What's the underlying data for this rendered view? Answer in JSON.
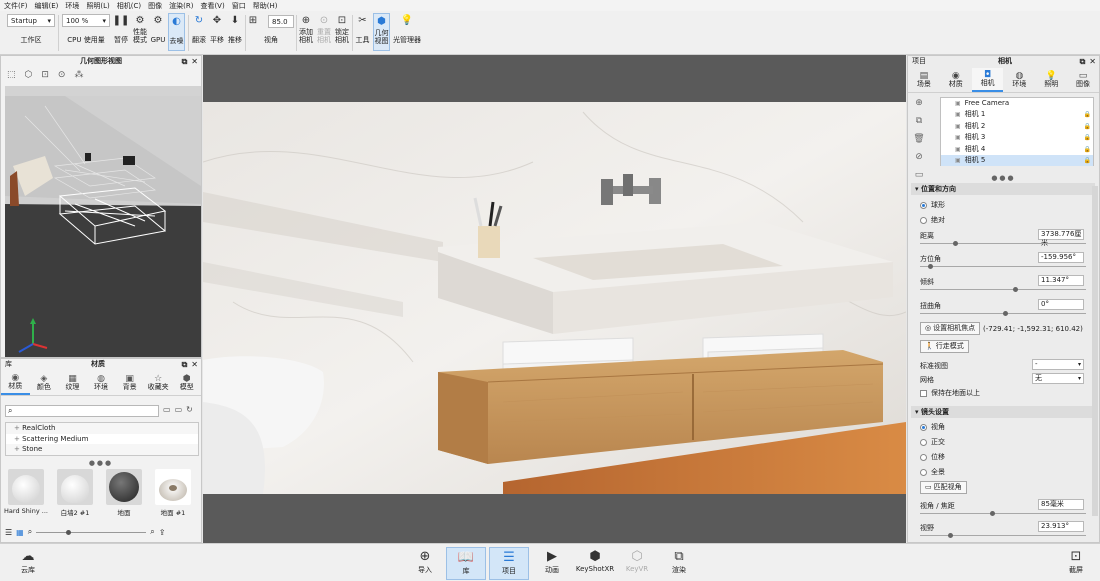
{
  "menu": [
    "文件(F)",
    "编辑(E)",
    "环境",
    "照明(L)",
    "相机(C)",
    "图像",
    "渲染(R)",
    "查看(V)",
    "窗口",
    "帮助(H)"
  ],
  "toolbar": {
    "workspace_value": "Startup",
    "workspace_label": "工作区",
    "cpu_value": "100 %",
    "cpu_label": "CPU 使用量",
    "pause": "暂停",
    "perf": "性能\n模式",
    "gpu": "GPU",
    "denoise": "去噪",
    "flip": "翻滚",
    "pan": "平移",
    "dolly": "推移",
    "fov_value": "85.0",
    "fov_label": "视角",
    "add_camera": "添加\n相机",
    "reset_camera": "重置\n相机",
    "lock_camera": "锁定\n相机",
    "tools": "工具",
    "geo_view": "几何\n视图",
    "light_manager": "光管理器"
  },
  "geometry_panel": {
    "title": "几何图形视图"
  },
  "library_panel": {
    "title": "材质",
    "tabs": [
      {
        "label": "材质",
        "icon": "material-icon"
      },
      {
        "label": "颜色",
        "icon": "color-icon"
      },
      {
        "label": "纹理",
        "icon": "texture-icon"
      },
      {
        "label": "环境",
        "icon": "environment-icon"
      },
      {
        "label": "背景",
        "icon": "background-icon"
      },
      {
        "label": "收藏夹",
        "icon": "favorites-icon"
      },
      {
        "label": "模型",
        "icon": "model-icon"
      }
    ],
    "tree": [
      "RealCloth",
      "Scattering Medium",
      "Stone"
    ],
    "thumbnails": [
      "Hard Shiny ...",
      "白墙2 #1",
      "地面",
      "地面 #1"
    ]
  },
  "project_panel": {
    "left_title": "项目",
    "title": "相机",
    "tabs": [
      {
        "label": "场景",
        "icon": "scene-icon"
      },
      {
        "label": "材质",
        "icon": "material-icon"
      },
      {
        "label": "相机",
        "icon": "camera-icon"
      },
      {
        "label": "环境",
        "icon": "environment-icon"
      },
      {
        "label": "照明",
        "icon": "lighting-icon"
      },
      {
        "label": "图像",
        "icon": "image-icon"
      }
    ],
    "cameras": [
      "Free Camera",
      "相机 1",
      "相机 2",
      "相机 3",
      "相机 4",
      "相机 5"
    ],
    "selected_camera": "相机 5",
    "position_section": "位置和方向",
    "mode_spherical": "球形",
    "mode_absolute": "绝对",
    "distance_label": "距离",
    "distance_value": "3738.776厘米",
    "distance_level": 0.2,
    "azimuth_label": "方位角",
    "azimuth_value": "-159.956°",
    "azimuth_level": 0.05,
    "incline_label": "倾斜",
    "incline_value": "11.347°",
    "incline_level": 0.56,
    "twist_label": "扭曲角",
    "twist_value": "0°",
    "twist_level": 0.5,
    "focus_btn": "设置相机焦点",
    "focus_coords": "(-729.41; -1,592.31; 610.42)",
    "walk_btn": "行走模式",
    "std_view_label": "标准视图",
    "std_view_value": "-",
    "grid_label": "网格",
    "grid_value": "无",
    "keep_above": "保持在地面以上",
    "lens_section": "镜头设置",
    "lens_perspective": "视角",
    "lens_ortho": "正交",
    "lens_shift": "位移",
    "lens_panorama": "全景",
    "match_btn": "匹配视角",
    "focal_label": "视角 / 焦距",
    "focal_value": "85毫米",
    "focal_level": 0.42,
    "fov_label": "视野",
    "fov_value": "23.913°",
    "fov_level": 0.17
  },
  "bottom_bar": {
    "cloud": "云库",
    "import": "导入",
    "library": "库",
    "project": "项目",
    "animation": "动画",
    "keyshotxr": "KeyShotXR",
    "keyvr": "KeyVR",
    "render": "渲染",
    "screenshot": "截屏"
  },
  "colors": {
    "accent": "#3a8ee6",
    "selected_row": "#cfe3f8",
    "viewport_bg": "#5a5a5a"
  }
}
